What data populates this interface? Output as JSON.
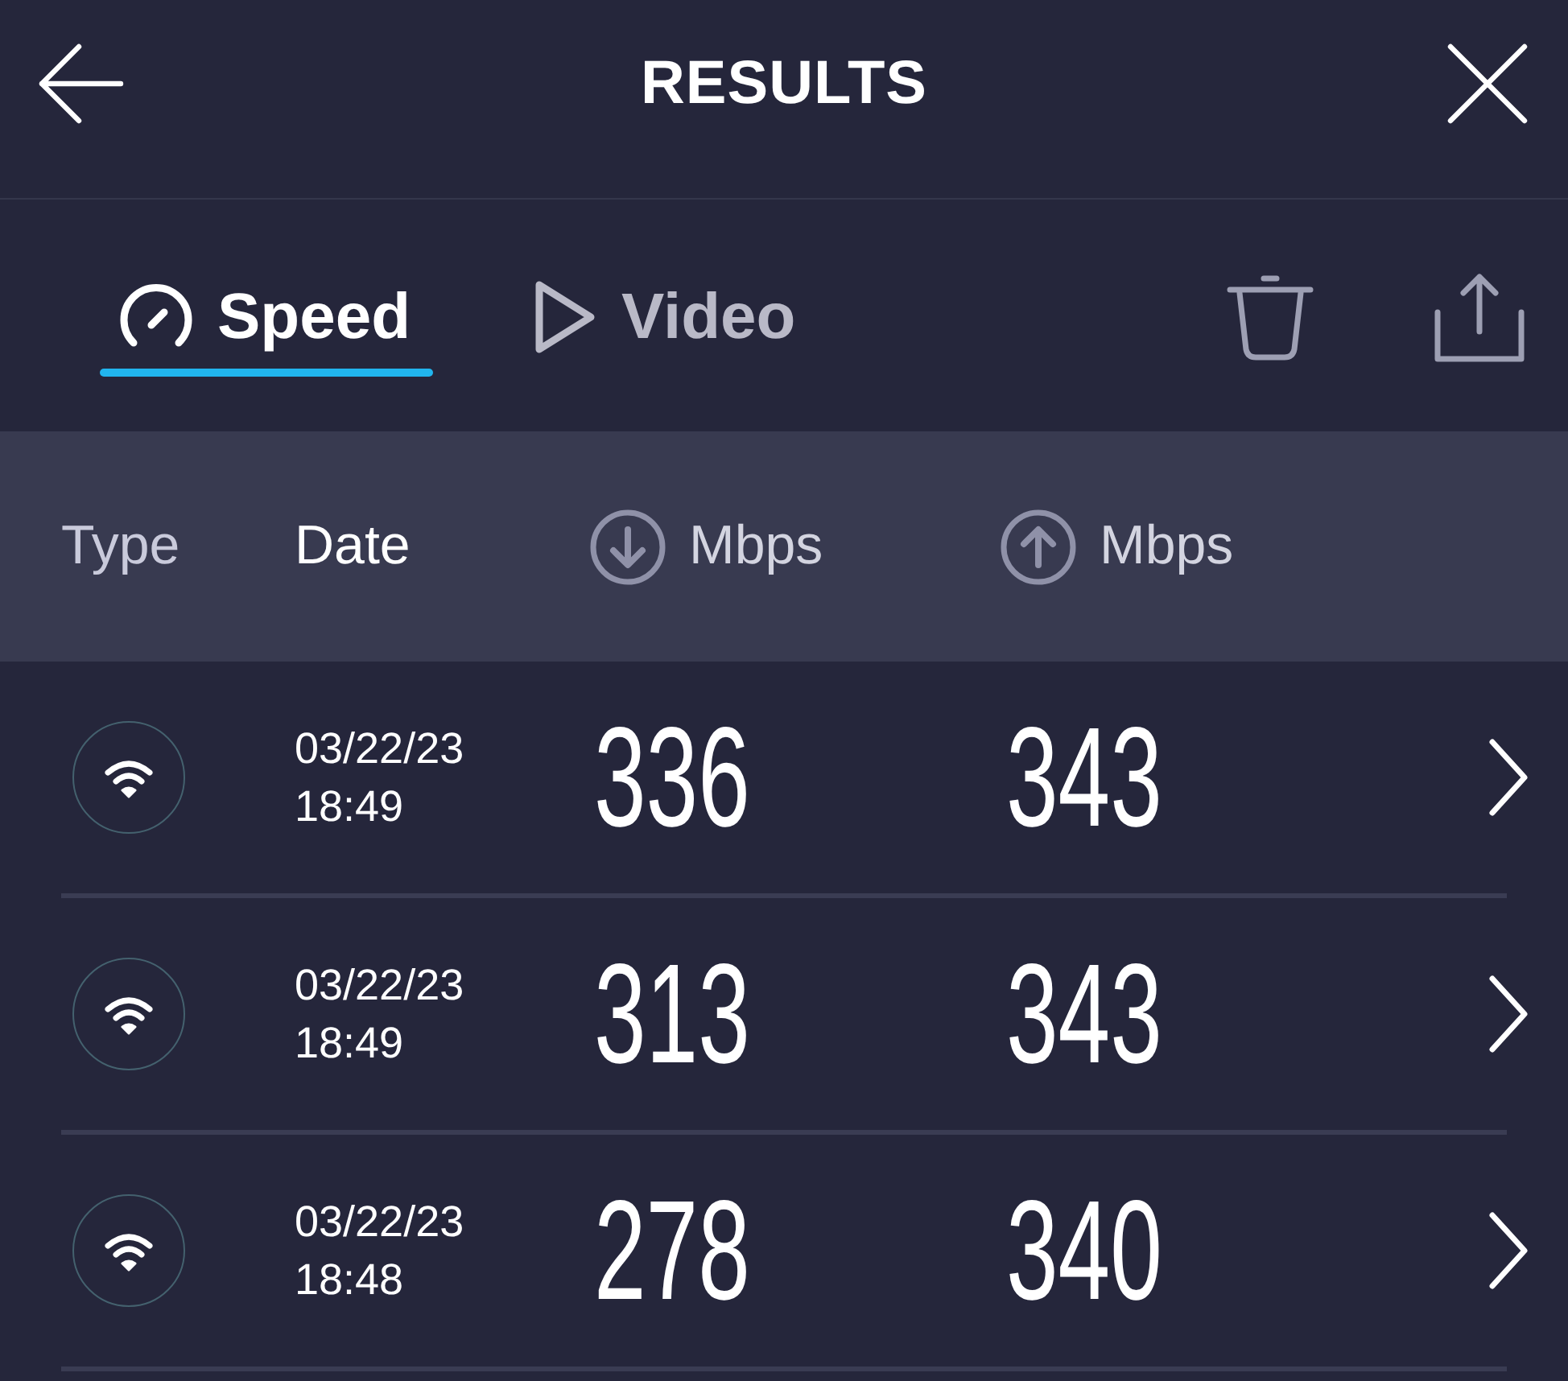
{
  "header": {
    "title": "RESULTS"
  },
  "tabs": [
    {
      "kind": "speed",
      "label": "Speed",
      "selected": true
    },
    {
      "kind": "video",
      "label": "Video",
      "selected": false
    }
  ],
  "table": {
    "columns": [
      {
        "kind": "type",
        "label": "Type"
      },
      {
        "kind": "date",
        "label": "Date"
      },
      {
        "kind": "download",
        "label": "Mbps"
      },
      {
        "kind": "upload",
        "label": "Mbps"
      }
    ],
    "rows": [
      {
        "kind": "wifi",
        "date": "03/22/23",
        "time": "18:49",
        "download": "336",
        "upload": "343"
      },
      {
        "kind": "wifi",
        "date": "03/22/23",
        "time": "18:49",
        "download": "313",
        "upload": "343"
      },
      {
        "kind": "wifi",
        "date": "03/22/23",
        "time": "18:48",
        "download": "278",
        "upload": "340"
      }
    ]
  }
}
